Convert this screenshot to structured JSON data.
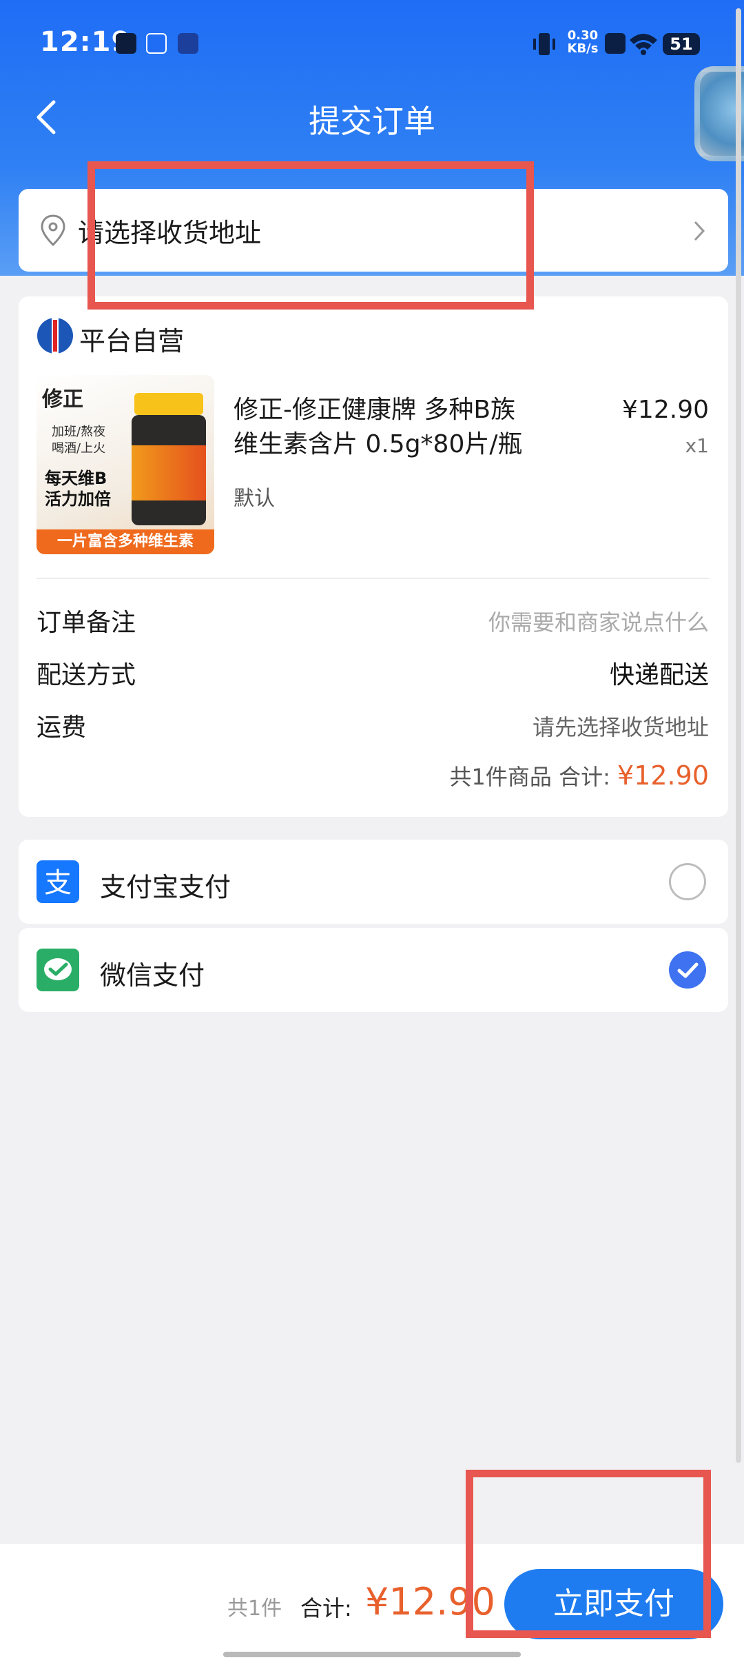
{
  "status_bar": {
    "time": "12:19",
    "net_speed_value": "0.30",
    "net_speed_unit": "KB/s",
    "battery": "51"
  },
  "header": {
    "title": "提交订单"
  },
  "address": {
    "placeholder": "请选择收货地址"
  },
  "order": {
    "store_name": "平台自营",
    "product": {
      "title": "修正-修正健康牌 多种B族维生素含片 0.5g*80片/瓶",
      "price": "¥12.90",
      "qty": "x1",
      "spec": "默认",
      "image_texts": {
        "brand": "修正",
        "tag1": "加班/熬夜",
        "tag2": "喝酒/上火",
        "slogan1": "每天维B",
        "slogan2": "活力加倍",
        "banner": "一片富含多种维生素"
      }
    },
    "remark_label": "订单备注",
    "remark_placeholder": "你需要和商家说点什么",
    "delivery_label": "配送方式",
    "delivery_value": "快递配送",
    "freight_label": "运费",
    "freight_value": "请先选择收货地址",
    "total_prefix": "共1件商品 合计:",
    "total_amount": "¥12.90"
  },
  "payment": {
    "alipay_label": "支付宝支付",
    "wechat_label": "微信支付",
    "alipay_selected": false,
    "wechat_selected": true
  },
  "bottom_bar": {
    "count": "共1件",
    "sum_label": "合计:",
    "sum_amount": "¥12.90",
    "pay_button": "立即支付"
  },
  "colors": {
    "header_blue": "#1f6df5",
    "price_orange": "#e8602c",
    "button_blue": "#1e7cf0",
    "highlight_red": "#e85650"
  }
}
